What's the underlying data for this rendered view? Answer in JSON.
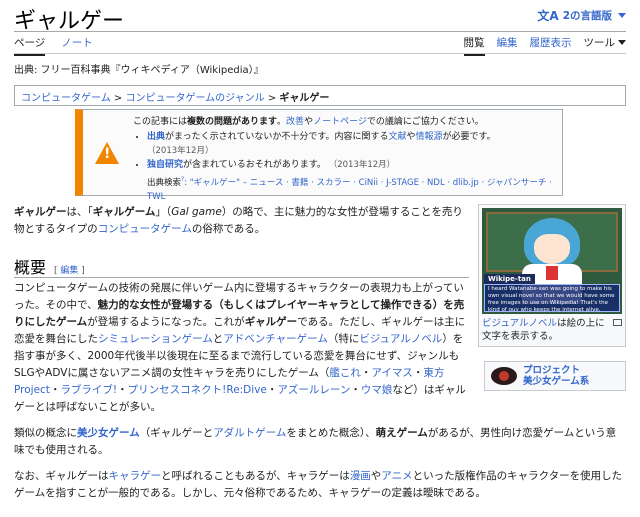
{
  "header": {
    "title": "ギャルゲー",
    "lang_label": "2の言語版",
    "tabs_left": [
      "ページ",
      "ノート"
    ],
    "tabs_right": [
      "閲覧",
      "編集",
      "履歴表示"
    ],
    "tools_label": "ツール"
  },
  "source_line": "出典: フリー百科事典『ウィキペディア（Wikipedia）』",
  "breadcrumb": {
    "item1": "コンピュータゲーム",
    "item2": "コンピュータゲームのジャンル",
    "current": "ギャルゲー",
    "sep": " > "
  },
  "ambox": {
    "intro_a": "この記事には",
    "intro_b": "複数の問題があります",
    "intro_c": "。",
    "intro_d": "改善",
    "intro_e": "や",
    "intro_f": "ノートページ",
    "intro_g": "での議論にご協力ください。",
    "issue1_a": "出典",
    "issue1_b": "がまったく示されていないか不十分です。内容に関する",
    "issue1_c": "文献",
    "issue1_d": "や",
    "issue1_e": "情報源",
    "issue1_f": "が必要です。",
    "issue1_date": "（2013年12月）",
    "issue2_a": "独自研究",
    "issue2_b": "が含まれているおそれがあります。",
    "issue2_date": "（2013年12月）",
    "search_label": "出典検索",
    "search_sup": "?",
    "search_rest": ": \"ギャルゲー\" – ニュース · 書籍 · スカラー · CiNii · J-STAGE · NDL · dlib.jp · ジャパンサーチ · TWL"
  },
  "lead": {
    "t1": "ギャルゲー",
    "t2": "は、「",
    "t3": "ギャルゲーム",
    "t4": "」（",
    "t5": "Gal game",
    "t6": "）の略で、主に魅力的な女性が登場することを売り物とするタイプの",
    "t7": "コンピュータゲーム",
    "t8": "の俗称である。"
  },
  "infobox": {
    "nametag": "Wikipe-tan",
    "message": "I heard Watanabe-san was going to make his own visual novel so that we would have some free images to use on Wikipedia! That's the kind of guy who keeps the internet alive, don't you think?",
    "board_text": "",
    "caption_link": "ビジュアルノベル",
    "caption_rest": "は絵の上に文字を表示する。"
  },
  "project": {
    "line1": "プロジェクト",
    "line2": "美少女ゲーム系"
  },
  "section": {
    "heading": "概要",
    "edit_open": "[",
    "edit_label": "編集",
    "edit_close": "]"
  },
  "para1": {
    "a": "コンピュータゲームの技術の発展に伴いゲーム内に登場するキャラクターの表現力も上がっていった。その中で、",
    "b": "魅力的な女性が登場する（もしくはプレイヤーキャラとして操作できる）を売りにしたゲーム",
    "c": "が登場するようになった。これが",
    "d": "ギャルゲー",
    "e": "である。ただし、ギャルゲーは主に恋愛を舞台にした",
    "f": "シミュレーションゲーム",
    "g": "と",
    "h": "アドベンチャーゲーム",
    "i": "（特に",
    "j": "ビジュアルノベル",
    "k": "）を指す事が多く、2000年代後半以後現在に至るまで流行している恋愛を舞台にせず、ジャンルもSLGやADVに属さないアニメ調の女性キャラを売りにしたゲーム（",
    "l": "艦これ",
    "m": "・",
    "n": "アイマス",
    "o": "・",
    "p": "東方Project",
    "q": "・",
    "r": "ラブライブ!",
    "s": "・",
    "t": "プリンセスコネクト!Re:Dive",
    "u": "・",
    "v": "アズールレーン",
    "w": "・",
    "x": "ウマ娘",
    "y": "など）はギャルゲーとは呼ばないことが多い。"
  },
  "para2": {
    "a": "類似の概念に",
    "b": "美少女ゲーム",
    "c": "（ギャルゲーと",
    "d": "アダルトゲーム",
    "e": "をまとめた概念）、",
    "f": "萌えゲーム",
    "g": "があるが、男性向け恋愛ゲームという意味でも使用される。"
  },
  "para3": {
    "a": "なお、ギャルゲーは",
    "b": "キャラゲー",
    "c": "と呼ばれることもあるが、キャラゲーは",
    "d": "漫画",
    "e": "や",
    "f": "アニメ",
    "g": "といった版権作品のキャラクターを使用したゲームを指すことが一般的である。しかし、元々俗称であるため、キャラゲーの定義は曖昧である。"
  },
  "colors": {
    "link": "#3366cc",
    "warning": "#f28500",
    "text": "#202122"
  }
}
